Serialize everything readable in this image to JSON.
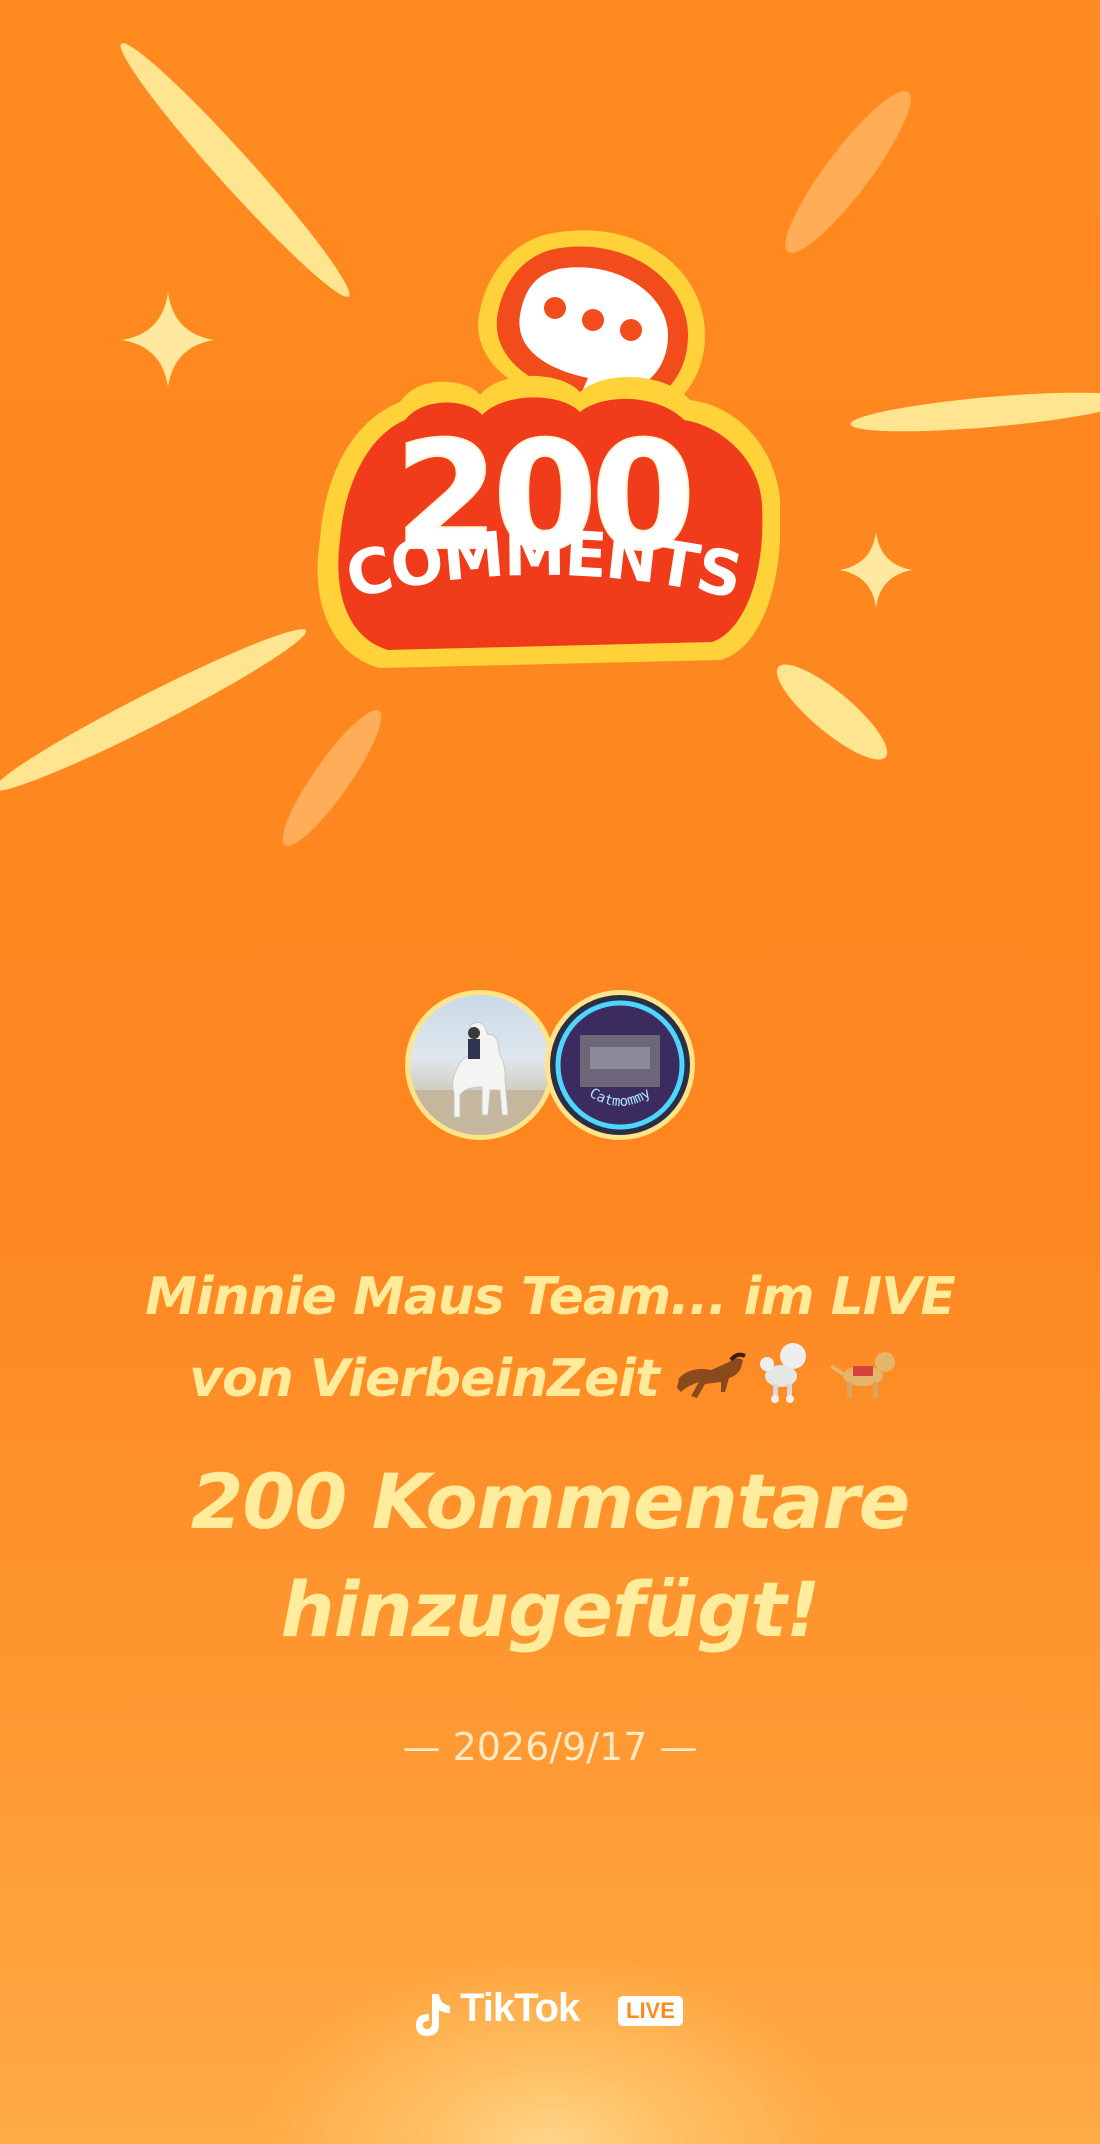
{
  "badge": {
    "count": "200",
    "label": "COMMENTS"
  },
  "avatars": [
    {
      "name": "host-avatar",
      "description_icon": "horse-rider-photo"
    },
    {
      "name": "commenter-avatar",
      "ring_text": "Catmommy"
    }
  ],
  "message": {
    "line1": "Minnie Maus Team... im LIVE",
    "line2": "von VierbeinZeit",
    "emojis": [
      "horse-icon",
      "poodle-icon",
      "service-dog-icon"
    ],
    "headline_line1": "200 Kommentare",
    "headline_line2": "hinzugefügt!"
  },
  "date": "— 2026/9/17 —",
  "brand": {
    "name": "TikTok",
    "badge": "LIVE"
  },
  "colors": {
    "background": "#fd8620",
    "accent_text": "#ffeb9a",
    "badge_red": "#f03c1a",
    "badge_rim": "#ffd23a"
  }
}
